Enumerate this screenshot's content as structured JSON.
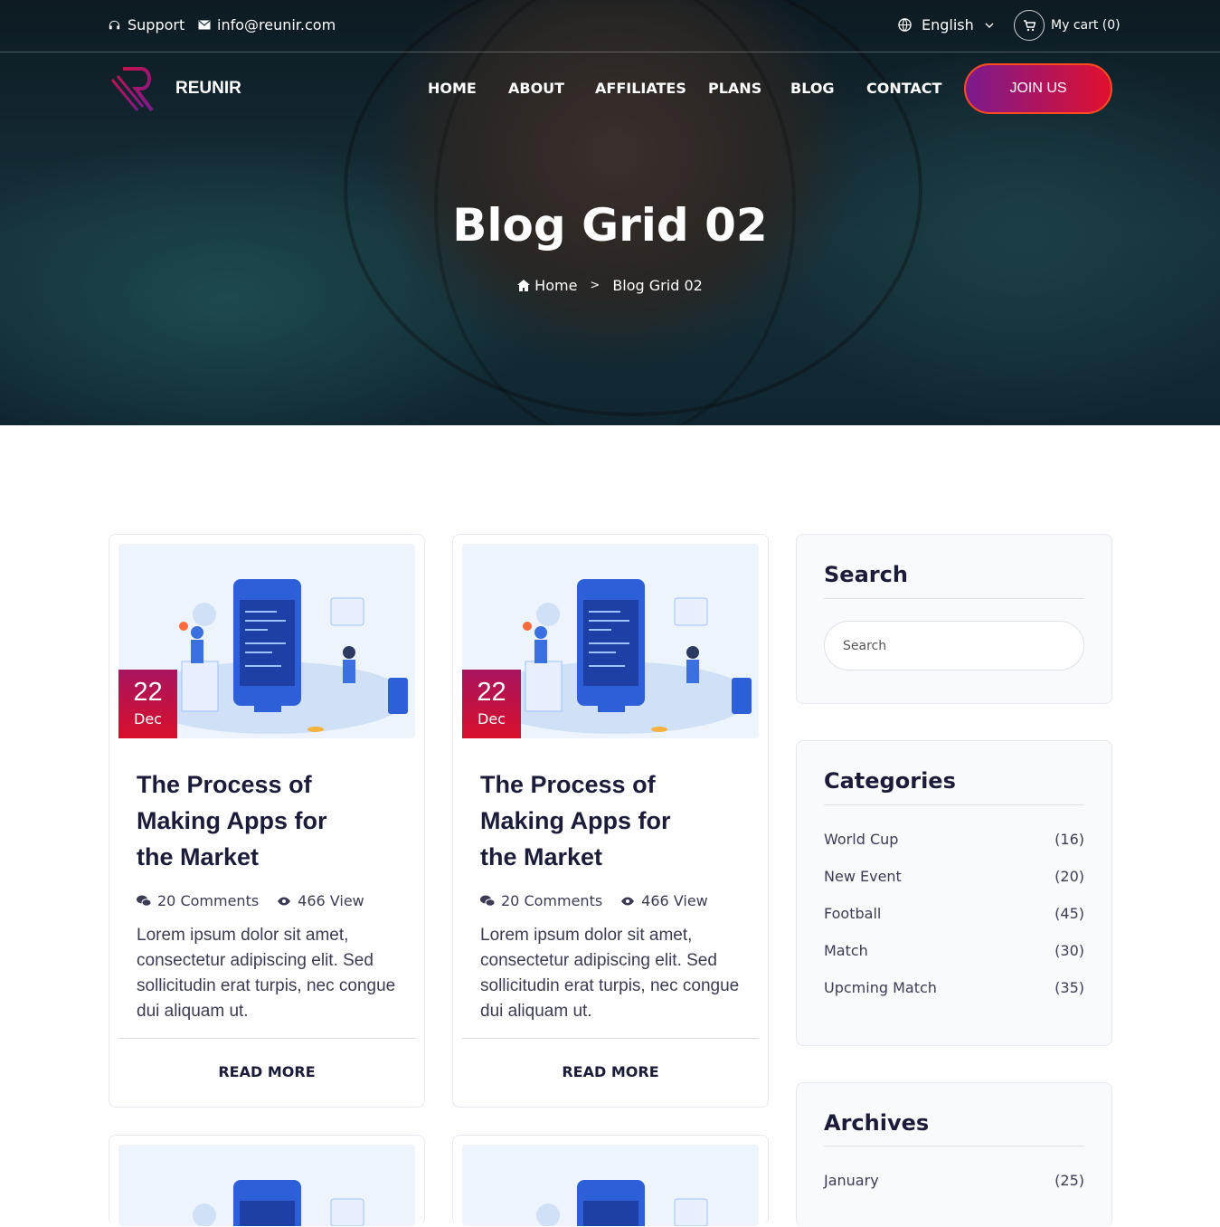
{
  "topbar": {
    "support": "Support",
    "email": "info@reunir.com",
    "language": "English",
    "cart": "My cart (0)"
  },
  "brand": {
    "name": "REUNIR"
  },
  "nav": {
    "items": [
      "HOME",
      "ABOUT",
      "AFFILIATES",
      "PLANS",
      "BLOG",
      "CONTACT"
    ],
    "cta": "JOIN US"
  },
  "hero": {
    "title": "Blog Grid 02",
    "breadcrumb_home": "Home",
    "breadcrumb_sep": ">",
    "breadcrumb_current": "Blog Grid 02"
  },
  "posts": [
    {
      "day": "22",
      "month": "Dec",
      "title": "The Process of Making Apps for the Market",
      "comments": "20 Comments",
      "views": "466 View",
      "excerpt": "Lorem ipsum dolor sit amet, consectetur adipiscing elit. Sed sollicitudin erat turpis, nec congue dui aliquam ut.",
      "read_more": "READ MORE"
    },
    {
      "day": "22",
      "month": "Dec",
      "title": "The Process of Making Apps for the Market",
      "comments": "20 Comments",
      "views": "466 View",
      "excerpt": "Lorem ipsum dolor sit amet, consectetur adipiscing elit. Sed sollicitudin erat turpis, nec congue dui aliquam ut.",
      "read_more": "READ MORE"
    }
  ],
  "sidebar": {
    "search_title": "Search",
    "search_placeholder": "Search",
    "categories_title": "Categories",
    "categories": [
      {
        "name": "World Cup",
        "count": "(16)"
      },
      {
        "name": "New Event",
        "count": "(20)"
      },
      {
        "name": "Football",
        "count": "(45)"
      },
      {
        "name": "Match",
        "count": "(30)"
      },
      {
        "name": "Upcming Match",
        "count": "(35)"
      }
    ],
    "archives_title": "Archives",
    "archives": [
      {
        "name": "January",
        "count": "(25)"
      }
    ]
  },
  "colors": {
    "accent_start": "#7b1a8e",
    "accent_end": "#e0102f",
    "heading": "#1b1b3a"
  }
}
